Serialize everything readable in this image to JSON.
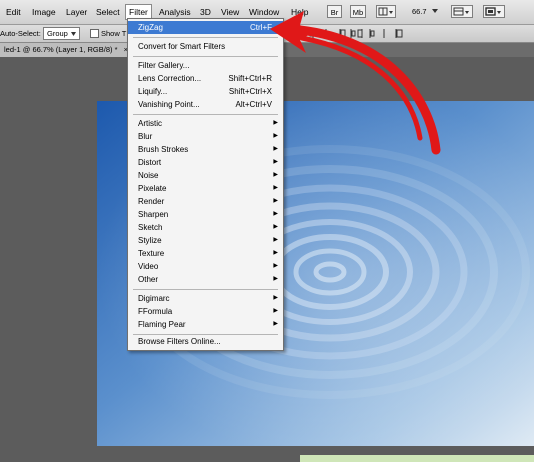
{
  "menubar": {
    "items": [
      "Edit",
      "Image",
      "Layer",
      "Select",
      "Filter",
      "Analysis",
      "3D",
      "View",
      "Window",
      "Help"
    ],
    "active_item": "Filter",
    "br_label": "Br",
    "mb_label": "Mb",
    "zoom_value": "66.7"
  },
  "options_bar": {
    "auto_select_label": "Auto-Select:",
    "auto_select_value": "Group",
    "show_transform_label": "Show T"
  },
  "document_tab": {
    "title": "led-1 @ 66.7% (Layer 1, RGB/8) *"
  },
  "filter_menu": {
    "last_filter": {
      "label": "ZigZag",
      "shortcut": "Ctrl+F"
    },
    "convert_smart": "Convert for Smart Filters",
    "group_filters": [
      {
        "label": "Filter Gallery...",
        "shortcut": ""
      },
      {
        "label": "Lens Correction...",
        "shortcut": "Shift+Ctrl+R"
      },
      {
        "label": "Liquify...",
        "shortcut": "Shift+Ctrl+X"
      },
      {
        "label": "Vanishing Point...",
        "shortcut": "Alt+Ctrl+V"
      }
    ],
    "submenus": [
      "Artistic",
      "Blur",
      "Brush Strokes",
      "Distort",
      "Noise",
      "Pixelate",
      "Render",
      "Sharpen",
      "Sketch",
      "Stylize",
      "Texture",
      "Video",
      "Other"
    ],
    "plugins": [
      "Digimarc",
      "FFormula",
      "Flaming Pear"
    ],
    "browse_online": "Browse Filters Online..."
  },
  "colors": {
    "menu_highlight": "#3d7ad2",
    "annotation_arrow": "#e01818"
  }
}
